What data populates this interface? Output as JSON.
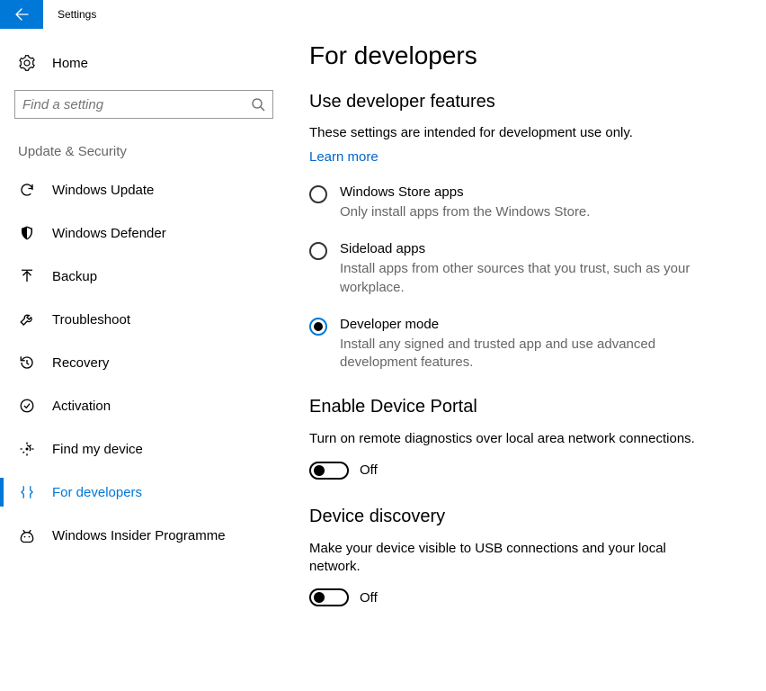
{
  "titlebar": {
    "title": "Settings"
  },
  "sidebar": {
    "home_label": "Home",
    "search_placeholder": "Find a setting",
    "section_header": "Update & Security",
    "items": [
      {
        "label": "Windows Update"
      },
      {
        "label": "Windows Defender"
      },
      {
        "label": "Backup"
      },
      {
        "label": "Troubleshoot"
      },
      {
        "label": "Recovery"
      },
      {
        "label": "Activation"
      },
      {
        "label": "Find my device"
      },
      {
        "label": "For developers"
      },
      {
        "label": "Windows Insider Programme"
      }
    ]
  },
  "main": {
    "title": "For developers",
    "dev_features": {
      "heading": "Use developer features",
      "intro": "These settings are intended for development use only.",
      "learn_more": "Learn more",
      "options": [
        {
          "label": "Windows Store apps",
          "desc": "Only install apps from the Windows Store."
        },
        {
          "label": "Sideload apps",
          "desc": "Install apps from other sources that you trust, such as your workplace."
        },
        {
          "label": "Developer mode",
          "desc": "Install any signed and trusted app and use advanced development features."
        }
      ],
      "selected_index": 2
    },
    "device_portal": {
      "heading": "Enable Device Portal",
      "desc": "Turn on remote diagnostics over local area network connections.",
      "state": "Off"
    },
    "device_discovery": {
      "heading": "Device discovery",
      "desc": "Make your device visible to USB connections and your local network.",
      "state": "Off"
    }
  }
}
